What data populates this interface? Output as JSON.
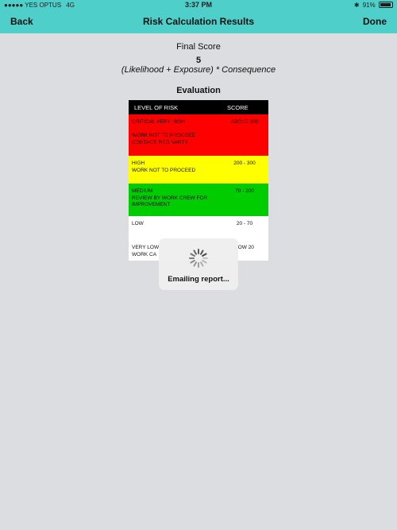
{
  "status_bar": {
    "carrier": "●●●●● YES OPTUS",
    "network": "4G",
    "time": "3:37 PM",
    "bluetooth": "✱",
    "battery_percent": "91%",
    "battery_level": 0.91
  },
  "nav": {
    "back_label": "Back",
    "title": "Risk Calculation Results",
    "done_label": "Done"
  },
  "results": {
    "final_score_label": "Final Score",
    "final_score_value": "5",
    "formula": "(Likelihood + Exposure) * Consequence",
    "evaluation_label": "Evaluation"
  },
  "risk_table": {
    "headers": [
      "LEVEL OF RISK",
      "SCORE"
    ],
    "rows": [
      {
        "lines": [
          "CRITICAL VERY HIGH",
          "",
          "WORK NOT TO PROCEED",
          "CONTACT: REG VARTY"
        ],
        "score": "ABOVE 300",
        "color": "#ff0000"
      },
      {
        "lines": [
          "HIGH",
          "WORK NOT TO PROCEED"
        ],
        "score": "200 - 300",
        "color": "#ffff00"
      },
      {
        "lines": [
          "MEDIUM",
          "REVIEW BY WORK CREW FOR",
          "IMPROVEMENT"
        ],
        "score": "70 - 200",
        "color": "#00cc00"
      },
      {
        "lines": [
          "LOW"
        ],
        "score": "20 - 70",
        "color": "#ffffff"
      },
      {
        "lines": [
          "VERY LOW",
          "WORK CA"
        ],
        "score": "LOW 20",
        "color": "#ffffff"
      }
    ]
  },
  "overlay": {
    "text": "Emailing report...",
    "icon": "activity-spinner-icon"
  },
  "colors": {
    "nav_bg": "#4ecfca",
    "page_bg": "#dcdde0"
  }
}
